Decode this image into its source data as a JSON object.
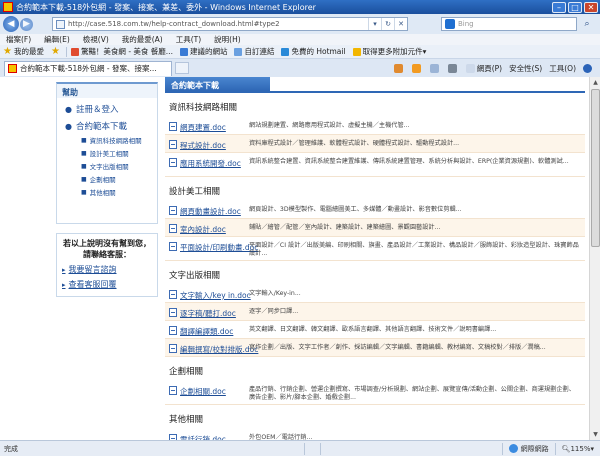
{
  "window": {
    "title": "合約範本下載-518外包網 - 發案、接案、兼差、委外 - Windows Internet Explorer"
  },
  "address": {
    "url": "http://case.518.com.tw/help-contract_download.html#type2"
  },
  "search": {
    "placeholder": "Bing"
  },
  "menu": [
    "檔案(F)",
    "編輯(E)",
    "檢視(V)",
    "我的最愛(A)",
    "工具(T)",
    "說明(H)"
  ],
  "favorites": {
    "label": "我的最愛",
    "items": [
      "驚豔！美食網 - 美食 餐廳...",
      "建議的網站",
      "自訂連結",
      "免費的 Hotmail",
      "取得更多附加元件"
    ]
  },
  "tab": {
    "title": "合約範本下載-518外包網 - 發案、接案..."
  },
  "commands": [
    "網頁(P)",
    "安全性(S)",
    "工具(O)"
  ],
  "sidebar": {
    "header": "幫助",
    "links": [
      "註冊＆登入",
      "合約範本下載"
    ],
    "subs": [
      "資訊科技網路相關",
      "設計美工相關",
      "文字出版相關",
      "企劃相關",
      "其他相關"
    ]
  },
  "contact": {
    "question": "若以上說明沒有幫到您，請聯絡客服：",
    "links": [
      "我要留言諮詢",
      "查看客服回覆"
    ]
  },
  "main": {
    "header": "合約範本下載",
    "sections": [
      {
        "title": "資訊科技網路相關",
        "rows": [
          {
            "file": "網頁建置.doc",
            "desc": "網站規劃建置、網路應用程式設計、虛擬主機／主機代管..."
          },
          {
            "file": "程式設計.doc",
            "desc": "資料庫程式設計／管理維護、軟體程式設計、硬體程式設計、驅動程式設計..."
          },
          {
            "file": "應用系統開發.doc",
            "desc": "資訊系統整合建置、資訊系統整合建置維護、傳訊系統建置管理、系統分析與設計、ERP(企業資源規劃)、軟體測試..."
          }
        ]
      },
      {
        "title": "設計美工相關",
        "rows": [
          {
            "file": "網頁動畫設計.doc",
            "desc": "網頁設計、3D模型製作、電腦繪圖美工、多媒體／動畫設計、影音數位剪輯..."
          },
          {
            "file": "室內設計.doc",
            "desc": "鋪貼／繪管／配管／室內設計、建築設計、建築繪圖、景觀園藝設計..."
          },
          {
            "file": "平面設計/印刷動畫.doc",
            "desc": "平面設計／CI 設計／出版美編、印刷相關、旗畫、產品設計／工業設計、構品設計／服飾設計、彩妝造型設計、珠寶飾品設計..."
          }
        ]
      },
      {
        "title": "文字出版相關",
        "rows": [
          {
            "file": "文字輸入/key in.doc",
            "desc": "文字輸入/Key-in..."
          },
          {
            "file": "逐字稿/聽打.doc",
            "desc": "逐字／同步口譯..."
          },
          {
            "file": "翻譯編譯類.doc",
            "desc": "英文翻譯、日文翻譯、韓文翻譯、歐系語言翻譯、其他語言翻譯、技術文件／說明書編譯..."
          },
          {
            "file": "編輯撰寫/校對排版.doc",
            "desc": "寫作企劃／出版、文字工作者／創作、採訪編輯／文字編輯、書籍編輯、教材編寫、文稿校對／排版／潤稿..."
          }
        ]
      },
      {
        "title": "企劃相關",
        "rows": [
          {
            "file": "企劃相關.doc",
            "desc": "產品行銷、行銷企劃、營運企劃撰寫、市場調查/分析規劃、網站企劃、展覽宣傳/活動企劃、公關企劃、商運規劃企劃、廣告企劃、影片/腳本企劃、婚戲企劃..."
          }
        ]
      },
      {
        "title": "其他相關",
        "rows": [
          {
            "file": "電話行銷.doc",
            "desc": "外包OEM／電話行銷..."
          }
        ]
      }
    ]
  },
  "status": {
    "done": "完成",
    "zone": "網際網路",
    "zoom": "115%"
  }
}
